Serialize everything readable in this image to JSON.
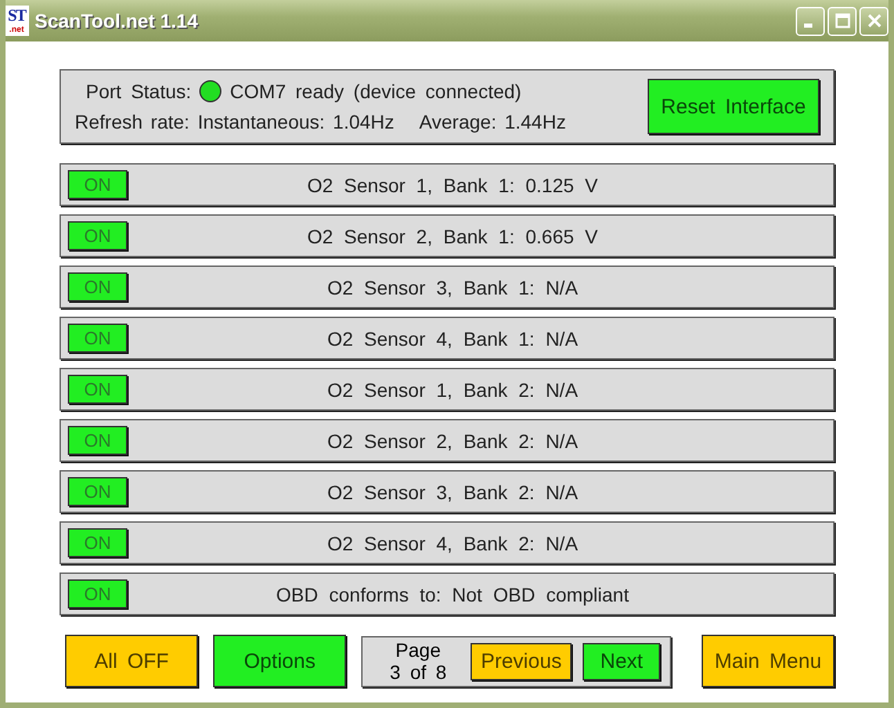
{
  "window": {
    "title": "ScanTool.net 1.14",
    "icon_text": "ST",
    "icon_subtext": ".net"
  },
  "status": {
    "label": "Port Status:",
    "connected": true,
    "message": "COM7 ready (device connected)",
    "refresh": "Refresh rate: Instantaneous: 1.04Hz",
    "average": "Average: 1.44Hz",
    "button": {
      "label": "Reset Interface",
      "color": "#22ee22"
    }
  },
  "sensors": [
    {
      "toggle": "ON",
      "on": true,
      "text": "O2 Sensor 1, Bank 1: 0.125 V"
    },
    {
      "toggle": "ON",
      "on": true,
      "text": "O2 Sensor 2, Bank 1: 0.665 V"
    },
    {
      "toggle": "ON",
      "on": true,
      "text": "O2 Sensor 3, Bank 1: N/A"
    },
    {
      "toggle": "ON",
      "on": true,
      "text": "O2 Sensor 4, Bank 1: N/A"
    },
    {
      "toggle": "ON",
      "on": true,
      "text": "O2 Sensor 1, Bank 2: N/A"
    },
    {
      "toggle": "ON",
      "on": true,
      "text": "O2 Sensor 2, Bank 2: N/A"
    },
    {
      "toggle": "ON",
      "on": true,
      "text": "O2 Sensor 3, Bank 2: N/A"
    },
    {
      "toggle": "ON",
      "on": true,
      "text": "O2 Sensor 4, Bank 2: N/A"
    },
    {
      "toggle": "ON",
      "on": true,
      "text": "OBD conforms to: Not OBD compliant"
    }
  ],
  "footer": {
    "all_off": {
      "label": "All OFF",
      "color": "#ffcc00"
    },
    "options": {
      "label": "Options",
      "color": "#22ee22"
    },
    "page_label": "Page",
    "page_count": "3 of 8",
    "previous": {
      "label": "Previous",
      "color": "#ffcc00"
    },
    "next": {
      "label": "Next",
      "color": "#22ee22"
    },
    "main_menu": {
      "label": "Main Menu",
      "color": "#ffcc00"
    }
  }
}
